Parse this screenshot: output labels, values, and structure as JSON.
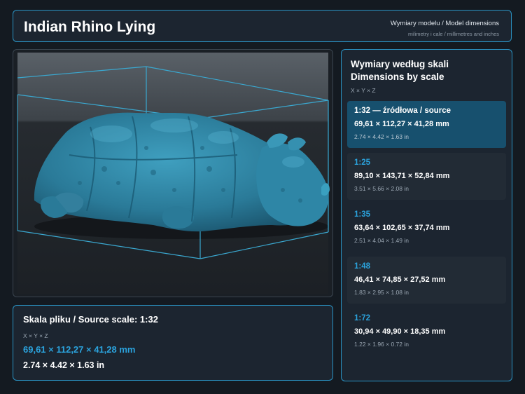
{
  "header": {
    "title": "Indian Rhino Lying",
    "subtitle": "Wymiary modelu / Model dimensions",
    "units_note": "milimetry i cale / millimetres and inches"
  },
  "viewport": {
    "subject": "rhino-model",
    "colors": {
      "model": "#2d7f9c",
      "bbox": "#3aa8d0",
      "background": "#1a1f25"
    }
  },
  "source": {
    "title": "Skala pliku / Source scale: 1:32",
    "axes": "X × Y × Z",
    "mm": "69,61 × 112,27 × 41,28 mm",
    "inches": "2.74 × 4.42 × 1.63 in"
  },
  "scales": {
    "title_line1": "Wymiary według skali",
    "title_line2": "Dimensions by scale",
    "axes": "X × Y × Z",
    "items": [
      {
        "label": "1:32  —  źródłowa / source",
        "mm": "69,61 × 112,27 × 41,28 mm",
        "inches": "2.74 × 4.42 × 1.63 in"
      },
      {
        "label": "1:25",
        "mm": "89,10 × 143,71 × 52,84 mm",
        "inches": "3.51 × 5.66 × 2.08 in"
      },
      {
        "label": "1:35",
        "mm": "63,64 × 102,65 × 37,74 mm",
        "inches": "2.51 × 4.04 × 1.49 in"
      },
      {
        "label": "1:48",
        "mm": "46,41 × 74,85 × 27,52 mm",
        "inches": "1.83 × 2.95 × 1.08 in"
      },
      {
        "label": "1:72",
        "mm": "30,94 × 49,90 × 18,35 mm",
        "inches": "1.22 × 1.96 × 0.72 in"
      }
    ]
  },
  "accent_color": "#2ba3dd"
}
